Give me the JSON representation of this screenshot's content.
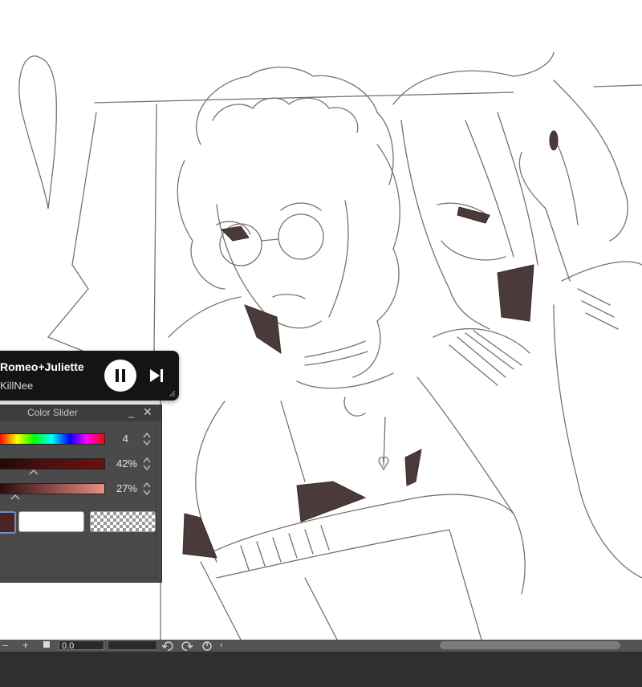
{
  "media_player": {
    "track_title": "Romeo+Juliette",
    "artist": "KillNee"
  },
  "color_slider": {
    "title": "Color Slider",
    "hue_value": "4",
    "saturation_value": "42%",
    "brightness_value": "27%",
    "main_color": "#4b2424",
    "sub_color": "#ffffff"
  },
  "toolbar": {
    "zoom_value": "0.0"
  }
}
